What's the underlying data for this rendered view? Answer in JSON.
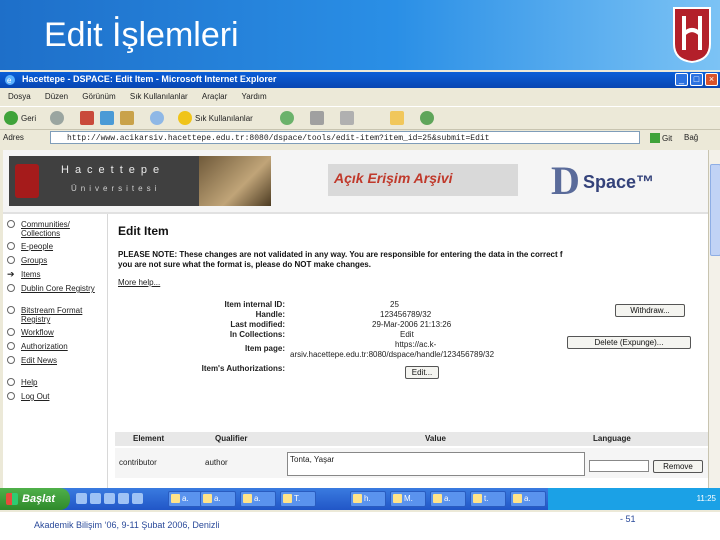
{
  "slide": {
    "title": "Edit İşlemleri",
    "footer": "Akademik Bilişim ‘06, 9-11 Şubat 2006, Denizli",
    "page_number": "- 51"
  },
  "window": {
    "title": "Hacettepe - DSPACE: Edit Item - Microsoft Internet Explorer",
    "menu": [
      "Dosya",
      "Düzen",
      "Görünüm",
      "Sık Kullanılanlar",
      "Araçlar",
      "Yardım"
    ],
    "toolbar": {
      "back": "Geri",
      "favorites": "Sık Kullanılanlar"
    },
    "address_label": "Adres",
    "address_url": "http://www.acikarsiv.hacettepe.edu.tr:8080/dspace/tools/edit-item?item_id=25&submit=Edit",
    "go": "Git",
    "links": "Bağ"
  },
  "banner": {
    "university_name": "Hacettepe",
    "university_sub": "Üniversitesi",
    "archive_title": "Açık Erişim Arşivi",
    "dspace_d": "D",
    "dspace_rest": "Space™"
  },
  "sidebar": {
    "items": [
      {
        "label": "Communities/ Collections",
        "icon": "circle-icon"
      },
      {
        "label": "E-people",
        "icon": "circle-icon"
      },
      {
        "label": "Groups",
        "icon": "circle-icon"
      },
      {
        "label": "Items",
        "icon": "arrow-icon"
      },
      {
        "label": "Dublin Core Registry",
        "icon": "circle-icon"
      },
      {
        "label": "Bitstream Format Registry",
        "icon": "circle-icon"
      },
      {
        "label": "Workflow",
        "icon": "circle-icon"
      },
      {
        "label": "Authorization",
        "icon": "circle-icon"
      },
      {
        "label": "Edit News",
        "icon": "circle-icon"
      },
      {
        "label": "Help",
        "icon": "circle-icon"
      },
      {
        "label": "Log Out",
        "icon": "circle-icon"
      }
    ]
  },
  "main": {
    "title": "Edit Item",
    "note_line1": "PLEASE NOTE: These changes are not validated in any way. You are responsible for entering the data in the correct f",
    "note_line2": "you are not sure what the format is, please do NOT make changes.",
    "more_help": "More help...",
    "fields": {
      "internal_id_label": "Item internal ID:",
      "internal_id": "25",
      "handle_label": "Handle:",
      "handle": "123456789/32",
      "last_modified_label": "Last modified:",
      "last_modified": "29-Mar-2006 21:13:26",
      "collections_label": "In Collections:",
      "collections": "Edit",
      "item_page_label": "Item page:",
      "item_page_line1": "https://ac.k-",
      "item_page_line2": "arsiv.hacettepe.edu.tr:8080/dspace/handle/123456789/32",
      "authorizations_label": "Item's Authorizations:",
      "authorizations_button": "Edit..."
    },
    "withdraw_button": "Withdraw...",
    "delete_button": "Delete (Expunge)...",
    "table": {
      "headers": [
        "Element",
        "Qualifier",
        "Value",
        "Language"
      ],
      "row": {
        "element": "contributor",
        "qualifier": "author",
        "value": "Tonta, Yaşar",
        "remove": "Remove"
      }
    }
  },
  "taskbar": {
    "start": "Başlat",
    "tasks": [
      "a.",
      "a.",
      "a.",
      "T.",
      "h.",
      "M.",
      "a.",
      "t.",
      "a."
    ],
    "clock": "11:25"
  }
}
